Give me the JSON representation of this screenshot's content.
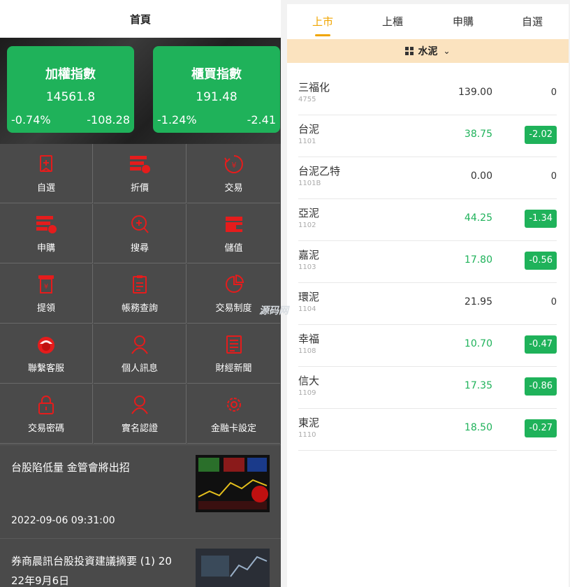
{
  "header": {
    "title": "首頁"
  },
  "indices": [
    {
      "name": "加權指數",
      "value": "14561.8",
      "pct": "-0.74%",
      "change": "-108.28"
    },
    {
      "name": "櫃買指數",
      "value": "191.48",
      "pct": "-1.24%",
      "change": "-2.41"
    }
  ],
  "menu": [
    {
      "label": "自選",
      "icon": "star-list-icon"
    },
    {
      "label": "折價",
      "icon": "discount-icon"
    },
    {
      "label": "交易",
      "icon": "trade-icon"
    },
    {
      "label": "申購",
      "icon": "subscribe-icon"
    },
    {
      "label": "搜尋",
      "icon": "search-icon"
    },
    {
      "label": "儲值",
      "icon": "wallet-icon"
    },
    {
      "label": "提領",
      "icon": "withdraw-icon"
    },
    {
      "label": "帳務查詢",
      "icon": "account-query-icon"
    },
    {
      "label": "交易制度",
      "icon": "pie-chart-icon"
    },
    {
      "label": "聯繫客服",
      "icon": "customer-service-icon"
    },
    {
      "label": "個人訊息",
      "icon": "user-icon"
    },
    {
      "label": "財經新聞",
      "icon": "news-icon"
    },
    {
      "label": "交易密碼",
      "icon": "lock-icon"
    },
    {
      "label": "實名認證",
      "icon": "user-verify-icon"
    },
    {
      "label": "金融卡設定",
      "icon": "gear-icon"
    }
  ],
  "news": [
    {
      "title": "台股陷低量 金管會將出招",
      "time": "2022-09-06 09:31:00"
    },
    {
      "title_line1": "券商晨訊台股投資建議摘要 (1) 20",
      "title_line2": "22年9月6日"
    }
  ],
  "tabs": [
    {
      "label": "上市",
      "active": true
    },
    {
      "label": "上櫃",
      "active": false
    },
    {
      "label": "申購",
      "active": false
    },
    {
      "label": "自選",
      "active": false
    }
  ],
  "category": {
    "label": "水泥"
  },
  "watermark": "源码网",
  "stocks": [
    {
      "name": "三福化",
      "code": "4755",
      "price": "139.00",
      "change": "0",
      "down": false
    },
    {
      "name": "台泥",
      "code": "1101",
      "price": "38.75",
      "change": "-2.02",
      "down": true
    },
    {
      "name": "台泥乙特",
      "code": "1101B",
      "price": "0.00",
      "change": "0",
      "down": false
    },
    {
      "name": "亞泥",
      "code": "1102",
      "price": "44.25",
      "change": "-1.34",
      "down": true
    },
    {
      "name": "嘉泥",
      "code": "1103",
      "price": "17.80",
      "change": "-0.56",
      "down": true
    },
    {
      "name": "環泥",
      "code": "1104",
      "price": "21.95",
      "change": "0",
      "down": false
    },
    {
      "name": "幸福",
      "code": "1108",
      "price": "10.70",
      "change": "-0.47",
      "down": true
    },
    {
      "name": "信大",
      "code": "1109",
      "price": "17.35",
      "change": "-0.86",
      "down": true
    },
    {
      "name": "東泥",
      "code": "1110",
      "price": "18.50",
      "change": "-0.27",
      "down": true
    }
  ],
  "colors": {
    "accent": "#f0a500",
    "down": "#1fb25a",
    "icon": "#e51c1c",
    "panel": "#4a4a4a",
    "category_bar": "#fbe3bf"
  }
}
